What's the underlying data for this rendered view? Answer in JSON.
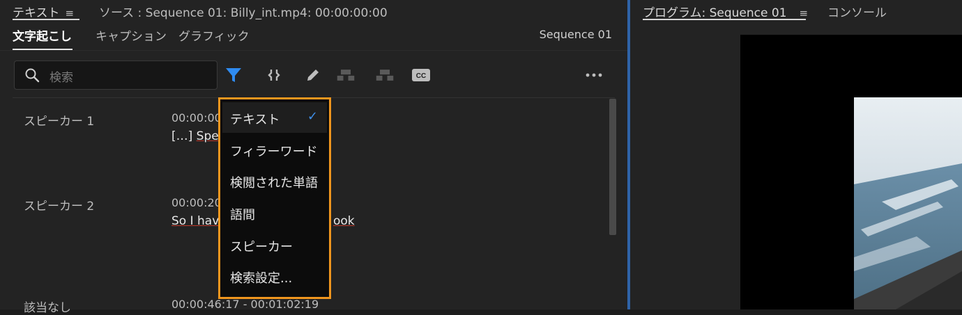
{
  "text_panel": {
    "tab_label": "テキスト",
    "tab_menu_glyph": "≡",
    "source_label": "ソース : Sequence 01: Billy_int.mp4: 00:00:00:00",
    "subtabs": [
      "文字起こし",
      "キャプション",
      "グラフィック"
    ],
    "sequence_label": "Sequence 01",
    "search": {
      "placeholder": "検索",
      "value": ""
    },
    "toolbar_icons": [
      "filter-icon",
      "split-segment-icon",
      "edit-icon",
      "merge-left-icon",
      "merge-right-icon",
      "cc-icon",
      "more-icon"
    ],
    "accent_color": "#2f8bf0",
    "transcript": [
      {
        "speaker": "スピーカー 1",
        "timecode": "00:00:00",
        "text_prefix": "[…] ",
        "text_visible": "Spea"
      },
      {
        "speaker": "スピーカー 2",
        "timecode": "00:00:20",
        "text_start": "So I have",
        "text_end": "ook"
      },
      {
        "speaker": "該当なし",
        "timecode": "00:00:46:17 - 00:01:02:19"
      }
    ]
  },
  "filter_menu": {
    "items": [
      "テキスト",
      "フィラーワード",
      "検閲された単語",
      "語間",
      "スピーカー",
      "検索設定..."
    ],
    "checked_index": 0,
    "check_glyph": "✓",
    "highlight_color": "#f0961e"
  },
  "program_panel": {
    "tab_label": "プログラム: Sequence 01",
    "tab_menu_glyph": "≡",
    "console_label": "コンソール"
  }
}
